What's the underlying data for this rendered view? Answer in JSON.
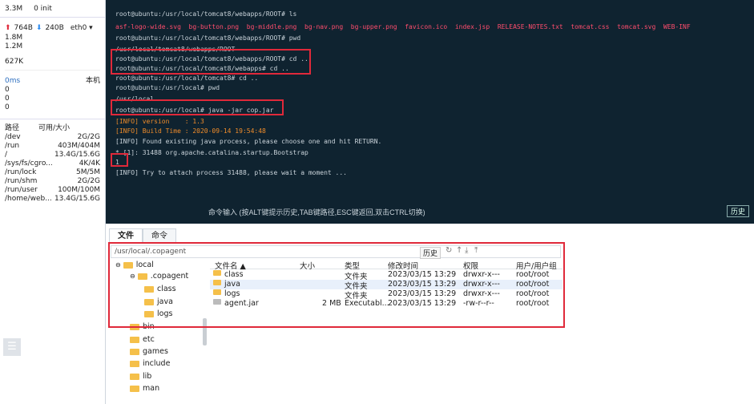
{
  "left_panel": {
    "top": {
      "mem": "3.3M",
      "init": "0 init"
    },
    "net": {
      "up": "764B",
      "down": "240B",
      "iface": "eth0",
      "values": [
        "1.8M",
        "1.2M",
        "627K"
      ]
    },
    "ping": {
      "label": "0ms",
      "host": "本机",
      "values": [
        "0",
        "0",
        "0"
      ]
    },
    "disk_header": {
      "path": "路径",
      "size": "可用/大小"
    },
    "disks": [
      {
        "path": "/dev",
        "size": "2G/2G"
      },
      {
        "path": "/run",
        "size": "403M/404M"
      },
      {
        "path": "/",
        "size": "13.4G/15.6G"
      },
      {
        "path": "/sys/fs/cgro...",
        "size": "4K/4K"
      },
      {
        "path": "/run/lock",
        "size": "5M/5M"
      },
      {
        "path": "/run/shm",
        "size": "2G/2G"
      },
      {
        "path": "/run/user",
        "size": "100M/100M"
      },
      {
        "path": "/home/web...",
        "size": "13.4G/15.6G"
      }
    ]
  },
  "terminal": {
    "lines": [
      "root@ubuntu:/usr/local/tomcat8/webapps/ROOT# ls",
      "asf-logo-wide.svg  bg-button.png  bg-middle.png  bg-nav.png  bg-upper.png  favicon.ico  index.jsp  RELEASE-NOTES.txt  tomcat.css  tomcat.svg  WEB-INF",
      "root@ubuntu:/usr/local/tomcat8/webapps/ROOT# pwd",
      "/usr/local/tomcat8/webapps/ROOT",
      "root@ubuntu:/usr/local/tomcat8/webapps/ROOT# cd ..",
      "root@ubuntu:/usr/local/tomcat8/webapps# cd ..",
      "root@ubuntu:/usr/local/tomcat8# cd ..",
      "root@ubuntu:/usr/local# pwd",
      "/usr/local",
      "root@ubuntu:/usr/local# java -jar cop.jar",
      "[INFO] version    : 1.3",
      "[INFO] Build Time : 2020-09-14 19:54:48",
      "[INFO] Found existing java process, please choose one and hit RETURN.",
      "* [1]: 31488 org.apache.catalina.startup.Bootstrap",
      "1",
      "[INFO] Try to attach process 31488, please wait a moment ..."
    ],
    "input_hint": "命令输入 (按ALT键提示历史,TAB键路径,ESC键返回,双击CTRL切换)",
    "history_button": "历史"
  },
  "files_panel": {
    "tabs": [
      "文件",
      "命令"
    ],
    "path": "/usr/local/.copagent",
    "history_label": "历史",
    "tree": [
      {
        "name": "local",
        "level": 0
      },
      {
        "name": ".copagent",
        "level": 1
      },
      {
        "name": "class",
        "level": 2
      },
      {
        "name": "java",
        "level": 2
      },
      {
        "name": "logs",
        "level": 2
      },
      {
        "name": "bin",
        "level": 1
      },
      {
        "name": "etc",
        "level": 1
      },
      {
        "name": "games",
        "level": 1
      },
      {
        "name": "include",
        "level": 1
      },
      {
        "name": "lib",
        "level": 1
      },
      {
        "name": "man",
        "level": 1
      }
    ],
    "columns": [
      "文件名 ▲",
      "大小",
      "类型",
      "修改时间",
      "权限",
      "用户/用户组"
    ],
    "rows": [
      {
        "name": "class",
        "size": "",
        "type": "文件夹",
        "mtime": "2023/03/15 13:29",
        "perm": "drwxr-x---",
        "owner": "root/root"
      },
      {
        "name": "java",
        "size": "",
        "type": "文件夹",
        "mtime": "2023/03/15 13:29",
        "perm": "drwxr-x---",
        "owner": "root/root"
      },
      {
        "name": "logs",
        "size": "",
        "type": "文件夹",
        "mtime": "2023/03/15 13:29",
        "perm": "drwxr-x---",
        "owner": "root/root"
      },
      {
        "name": "agent.jar",
        "size": "2 MB",
        "type": "Executabl...",
        "mtime": "2023/03/15 13:29",
        "perm": "-rw-r--r--",
        "owner": "root/root"
      }
    ]
  }
}
